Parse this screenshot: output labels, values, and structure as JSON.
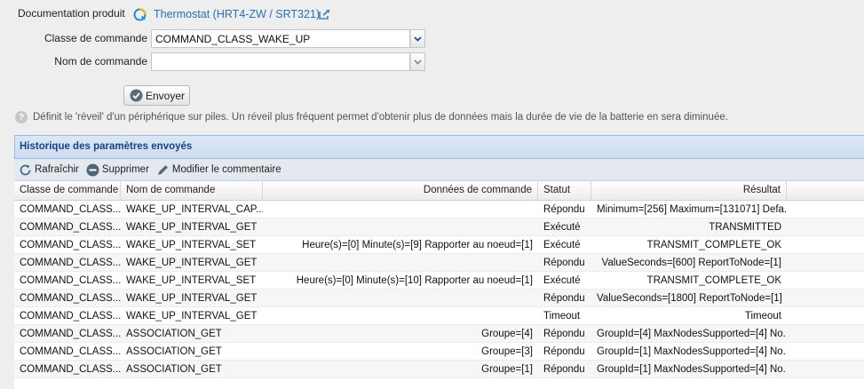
{
  "header": {
    "doc_label": "Documentation produit",
    "product_link": "Thermostat (HRT4-ZW / SRT321)"
  },
  "form": {
    "class_label": "Classe de commande",
    "class_value": "COMMAND_CLASS_WAKE_UP",
    "name_label": "Nom de commande",
    "name_value": "",
    "send_label": "Envoyer",
    "help_text": "Définit le 'réveil' d'un périphérique sur piles. Un réveil plus fréquent permet d'obtenir plus de données mais la durée de vie de la batterie en sera diminuée."
  },
  "history": {
    "title": "Historique des paramètres envoyés",
    "toolbar": {
      "refresh": "Rafraîchir",
      "delete": "Supprimer",
      "edit_comment": "Modifier le commentaire"
    },
    "columns": [
      "Classe de commande",
      "Nom de commande",
      "Données de commande",
      "Statut",
      "Résultat"
    ],
    "rows": [
      [
        "COMMAND_CLASS...",
        "WAKE_UP_INTERVAL_CAP...",
        "",
        "Répondu",
        "Minimum=[256] Maximum=[131071] Defa..."
      ],
      [
        "COMMAND_CLASS...",
        "WAKE_UP_INTERVAL_GET",
        "",
        "Exécuté",
        "TRANSMITTED"
      ],
      [
        "COMMAND_CLASS...",
        "WAKE_UP_INTERVAL_SET",
        "Heure(s)=[0] Minute(s)=[9] Rapporter au noeud=[1]",
        "Exécuté",
        "TRANSMIT_COMPLETE_OK"
      ],
      [
        "COMMAND_CLASS...",
        "WAKE_UP_INTERVAL_GET",
        "",
        "Répondu",
        "ValueSeconds=[600] ReportToNode=[1]"
      ],
      [
        "COMMAND_CLASS...",
        "WAKE_UP_INTERVAL_SET",
        "Heure(s)=[0] Minute(s)=[10] Rapporter au noeud=[1]",
        "Exécuté",
        "TRANSMIT_COMPLETE_OK"
      ],
      [
        "COMMAND_CLASS...",
        "WAKE_UP_INTERVAL_GET",
        "",
        "Répondu",
        "ValueSeconds=[1800] ReportToNode=[1]"
      ],
      [
        "COMMAND_CLASS...",
        "WAKE_UP_INTERVAL_GET",
        "",
        "Timeout",
        "Timeout"
      ],
      [
        "COMMAND_CLASS...",
        "ASSOCIATION_GET",
        "Groupe=[4]",
        "Répondu",
        "GroupId=[4] MaxNodesSupported=[4] No..."
      ],
      [
        "COMMAND_CLASS...",
        "ASSOCIATION_GET",
        "Groupe=[3]",
        "Répondu",
        "GroupId=[1] MaxNodesSupported=[4] No..."
      ],
      [
        "COMMAND_CLASS...",
        "ASSOCIATION_GET",
        "Groupe=[1]",
        "Répondu",
        "GroupId=[1] MaxNodesSupported=[4] No..."
      ]
    ]
  },
  "colors": {
    "link": "#2a6fb1",
    "panel_title": "#15428b",
    "panel_header_bg": "#cddcef"
  },
  "icons": [
    "zwave-logo-icon",
    "external-link-icon",
    "chevron-down-icon",
    "check-circle-icon",
    "help-icon",
    "refresh-icon",
    "minus-circle-icon",
    "pencil-icon"
  ]
}
